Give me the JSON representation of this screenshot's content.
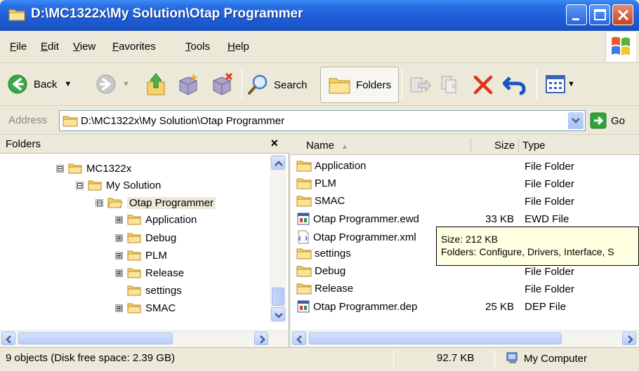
{
  "window": {
    "title": "D:\\MC1322x\\My Solution\\Otap Programmer"
  },
  "menu": {
    "file": "File",
    "edit": "Edit",
    "view": "View",
    "favorites": "Favorites",
    "tools": "Tools",
    "help": "Help"
  },
  "toolbar": {
    "back": "Back",
    "search": "Search",
    "folders": "Folders"
  },
  "address": {
    "label": "Address",
    "value": "D:\\MC1322x\\My Solution\\Otap Programmer",
    "go": "Go"
  },
  "folders": {
    "header": "Folders",
    "close": "×",
    "tree": [
      {
        "label": "MC1322x",
        "expander": "⊟"
      },
      {
        "label": "My Solution",
        "expander": "⊟"
      },
      {
        "label": "Otap Programmer",
        "expander": "⊟"
      },
      {
        "label": "Application",
        "expander": "⊞"
      },
      {
        "label": "Debug",
        "expander": "⊞"
      },
      {
        "label": "PLM",
        "expander": "⊞"
      },
      {
        "label": "Release",
        "expander": "⊞"
      },
      {
        "label": "settings",
        "expander": ""
      },
      {
        "label": "SMAC",
        "expander": "⊞"
      }
    ]
  },
  "list": {
    "columns": {
      "name": "Name",
      "size": "Size",
      "type": "Type"
    },
    "rows": [
      {
        "name": "Application",
        "size": "",
        "type": "File Folder",
        "icon": "folder"
      },
      {
        "name": "PLM",
        "size": "",
        "type": "File Folder",
        "icon": "folder"
      },
      {
        "name": "SMAC",
        "size": "",
        "type": "File Folder",
        "icon": "folder"
      },
      {
        "name": "Otap Programmer.ewd",
        "size": "33 KB",
        "type": "EWD File",
        "icon": "ewd-file"
      },
      {
        "name": "Otap Programmer.xml",
        "size": "",
        "type": "",
        "icon": "xml-file"
      },
      {
        "name": "settings",
        "size": "",
        "type": "",
        "icon": "folder"
      },
      {
        "name": "Debug",
        "size": "",
        "type": "File Folder",
        "icon": "folder"
      },
      {
        "name": "Release",
        "size": "",
        "type": "File Folder",
        "icon": "folder"
      },
      {
        "name": "Otap Programmer.dep",
        "size": "25 KB",
        "type": "DEP File",
        "icon": "dep-file"
      }
    ]
  },
  "tooltip": {
    "line1": "Size: 212 KB",
    "line2": "Folders: Configure, Drivers, Interface, S"
  },
  "status": {
    "objects": "9 objects (Disk free space: 2.39 GB)",
    "size": "92.7 KB",
    "location": "My Computer"
  }
}
